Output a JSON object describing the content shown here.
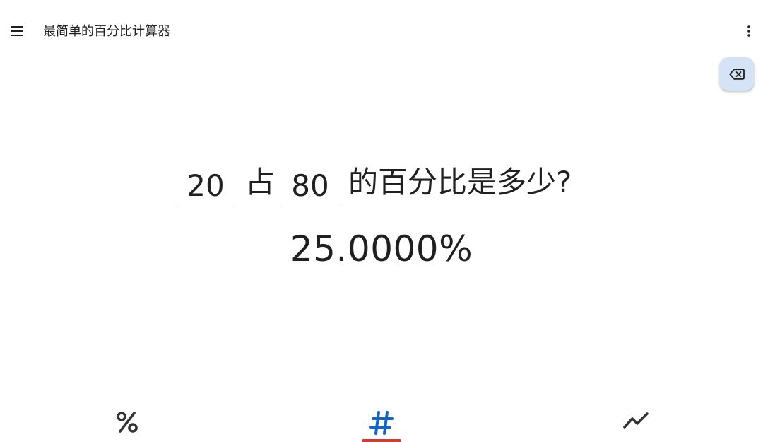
{
  "app_bar": {
    "title": "最简单的百分比计算器",
    "menu_icon": "menu-icon",
    "overflow_icon": "more-vert-icon",
    "backspace_icon": "backspace-icon",
    "backspace_bg_color": "#d5e3f7"
  },
  "question": {
    "value_a": "20",
    "word_of": "占",
    "value_b": "80",
    "suffix": "的百分比是多少?"
  },
  "result": {
    "text": "25.0000%"
  },
  "bottom_nav": {
    "tabs": [
      {
        "icon": "percent-icon",
        "selected": false
      },
      {
        "icon": "number-sign-icon",
        "selected": true
      },
      {
        "icon": "trending-icon",
        "selected": false
      }
    ],
    "selected_color": "#1565c0",
    "indicator_color": "#d93a2f"
  }
}
